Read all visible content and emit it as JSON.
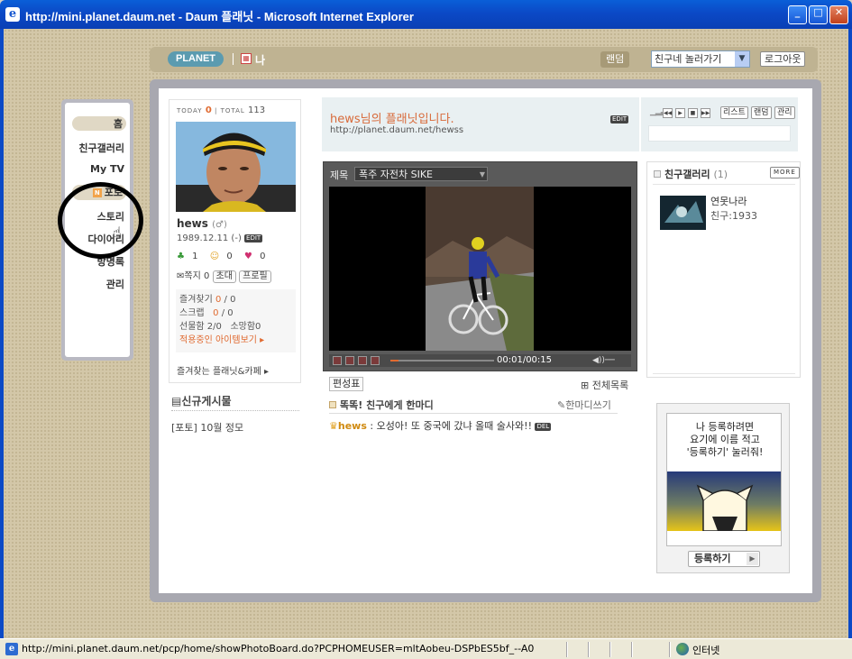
{
  "window": {
    "title": "http://mini.planet.daum.net - Daum 플래닛 - Microsoft Internet Explorer",
    "minimize": "_",
    "maximize": "□",
    "close": "✕"
  },
  "topbar": {
    "logo": "PLANET",
    "me_label": "나",
    "random_label": "랜덤",
    "friend_select": "친구네 놀러가기",
    "logout_label": "로그아웃"
  },
  "menu": {
    "home": "홈",
    "friend_gallery": "친구갤러리",
    "mytv": "My TV",
    "photo_badge": "N",
    "photo": "포토",
    "story": "스토리",
    "diary": "다이어리",
    "guestbook": "방명록",
    "manage": "관리"
  },
  "profile": {
    "today_label": "TODAY",
    "today_count": "0",
    "total_label": "TOTAL",
    "total_count": "113",
    "username": "hews",
    "gender": "(♂)",
    "birth": "1989.12.11 (-)",
    "edit": "EDIT",
    "stat_1": "1",
    "stat_2": "0",
    "stat_3": "0",
    "message_label": "쪽지",
    "message_count": "0",
    "invite_btn": "초대",
    "profile_btn": "프로필",
    "favorites_label": "즐겨찾기",
    "favorites_value": "0",
    "favorites_total": "0",
    "scrap_label": "스크랩",
    "scrap_value": "0",
    "scrap_total": "0",
    "gift_label": "선물함",
    "gift_value": "2/0",
    "wish_label": "소망함",
    "wish_value": "0",
    "items_label": "적용중인 아이템보기 ▸",
    "fav_planets": "즐겨찾는 플래닛&카페 ▸"
  },
  "newposts": {
    "title": "신규게시물",
    "item": "[포토] 10월 정모"
  },
  "header": {
    "greeting": "hews님의 플래닛입니다.",
    "url": "http://planet.daum.net/hewss",
    "edit": "EDIT"
  },
  "player": {
    "list_btn": "리스트",
    "random_btn": "랜덤",
    "manage_btn": "관리"
  },
  "video": {
    "title_label": "제목",
    "selected_title": "폭주 자전차 SIKE",
    "time": "00:01/00:15",
    "progress": 0.08
  },
  "board": {
    "schedule_btn": "편성표",
    "all_list": "⊞ 전체목록",
    "guest_title": "똑똑! 친구에게 한마디",
    "write_btn": "✎한마디쓰기",
    "entry_name": "hews",
    "entry_text": " : 오성아! 또 중국에 갔냐 올때 술사와!!",
    "del": "DEL"
  },
  "friend_gallery": {
    "title": "친구갤러리",
    "count": "(1)",
    "more": "MORE",
    "friend_name": "연못나라",
    "friend_count": "친구:1933"
  },
  "promo": {
    "line1": "나 등록하려면",
    "line2": "요기에 이름 적고",
    "line3": "'등록하기' 눌러줘!",
    "register_btn": "등록하기"
  },
  "statusbar": {
    "url": "http://mini.planet.daum.net/pcp/home/showPhotoBoard.do?PCPHOMEUSER=mltAobeu-DSPbES5bf_--A0",
    "zone": "인터넷"
  }
}
